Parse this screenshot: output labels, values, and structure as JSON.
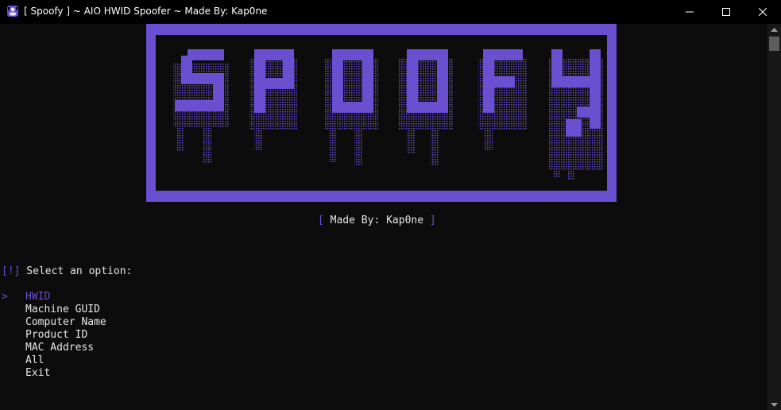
{
  "window": {
    "title": "[ Spoofy ] ~ AIO HWID Spoofer ~ Made By: Kap0ne",
    "minimize_icon": "minimize-icon",
    "maximize_icon": "maximize-icon",
    "close_icon": "close-icon"
  },
  "colors": {
    "accent": "#6a4fd0",
    "background": "#0c0c0c",
    "text": "#e6e6e6"
  },
  "banner": {
    "logo_text": "SPOOFY"
  },
  "credit": {
    "open": "[",
    "text": " Made By: Kap0ne ",
    "close": "]"
  },
  "prompt": {
    "tag": "[!]",
    "text": " Select an option:"
  },
  "menu": {
    "cursor": ">",
    "selected_index": 0,
    "items": [
      {
        "label": "HWID"
      },
      {
        "label": "Machine GUID"
      },
      {
        "label": "Computer Name"
      },
      {
        "label": "Product ID"
      },
      {
        "label": "MAC Address"
      },
      {
        "label": "All"
      },
      {
        "label": "Exit"
      }
    ]
  }
}
